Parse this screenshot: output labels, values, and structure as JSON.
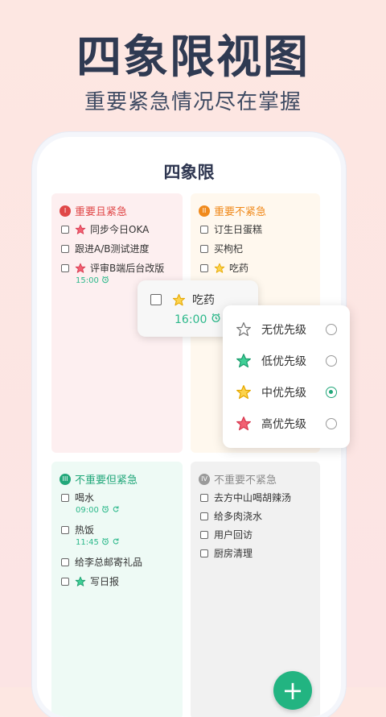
{
  "hero": {
    "title": "四象限视图",
    "subtitle": "重要紧急情况尽在掌握"
  },
  "app": {
    "title": "四象限"
  },
  "quadrants": [
    {
      "badge": "I",
      "title": "重要且紧急",
      "color": "#e04848",
      "items": [
        {
          "label": "同步今日OKA",
          "star": "red"
        },
        {
          "label": "跟进A/B测试进度",
          "star": ""
        },
        {
          "label": "评审B端后台改版",
          "star": "red",
          "time": "15:00"
        }
      ]
    },
    {
      "badge": "II",
      "title": "重要不紧急",
      "color": "#f08a1c",
      "items": [
        {
          "label": "订生日蛋糕"
        },
        {
          "label": "买枸杞"
        },
        {
          "label": "吃药",
          "star": "yellow"
        }
      ]
    },
    {
      "badge": "III",
      "title": "不重要但紧急",
      "color": "#22a77a",
      "items": [
        {
          "label": "喝水",
          "time": "09:00"
        },
        {
          "label": "热饭",
          "time": "11:45"
        },
        {
          "label": "给李总邮寄礼品"
        },
        {
          "label": "写日报",
          "star": "green"
        }
      ]
    },
    {
      "badge": "IV",
      "title": "不重要不紧急",
      "color": "#9a9a9a",
      "items": [
        {
          "label": "去方中山喝胡辣汤"
        },
        {
          "label": "给多肉浇水"
        },
        {
          "label": "用户回访"
        },
        {
          "label": "厨房清理"
        }
      ]
    }
  ],
  "drag_popup": {
    "label": "吃药",
    "time": "16:00"
  },
  "priority_menu": {
    "options": [
      {
        "label": "无优先级",
        "star": "gray",
        "selected": false
      },
      {
        "label": "低优先级",
        "star": "green",
        "selected": false
      },
      {
        "label": "中优先级",
        "star": "yellow",
        "selected": true
      },
      {
        "label": "高优先级",
        "star": "red",
        "selected": false
      }
    ]
  },
  "fab": {
    "label": "+"
  },
  "colors": {
    "accent": "#22b481",
    "red_star": "#f26072",
    "yellow_star": "#fcd34d",
    "green_star": "#3fcf96"
  }
}
